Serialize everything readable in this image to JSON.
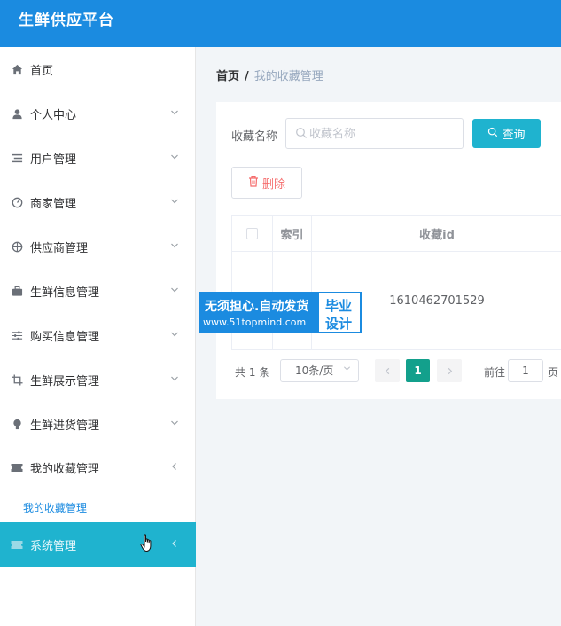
{
  "app": {
    "title": "生鲜供应平台"
  },
  "sidebar": {
    "items": [
      {
        "label": "首页",
        "icon": "home-icon"
      },
      {
        "label": "个人中心",
        "icon": "user-icon"
      },
      {
        "label": "用户管理",
        "icon": "list-icon"
      },
      {
        "label": "商家管理",
        "icon": "gauge-icon"
      },
      {
        "label": "供应商管理",
        "icon": "compass-icon"
      },
      {
        "label": "生鲜信息管理",
        "icon": "briefcase-icon"
      },
      {
        "label": "购买信息管理",
        "icon": "sliders-icon"
      },
      {
        "label": "生鲜展示管理",
        "icon": "crop-icon"
      },
      {
        "label": "生鲜进货管理",
        "icon": "bulb-icon"
      },
      {
        "label": "我的收藏管理",
        "icon": "ticket-icon"
      }
    ],
    "submenu": {
      "label": "我的收藏管理"
    },
    "active_item": {
      "label": "系统管理",
      "icon": "ticket-icon"
    }
  },
  "breadcrumb": {
    "home": "首页",
    "separator": "/",
    "current": "我的收藏管理"
  },
  "search": {
    "label": "收藏名称",
    "placeholder": "收藏名称",
    "value": "",
    "query_button": "查询"
  },
  "actions": {
    "delete_button": "删除"
  },
  "table": {
    "headers": {
      "index": "索引",
      "collect_id": "收藏id"
    },
    "rows": [
      {
        "collect_id": "1610462701529"
      }
    ]
  },
  "pagination": {
    "total": "共 1 条",
    "page_size": "10条/页",
    "current_page": "1",
    "goto_label": "前往",
    "goto_value": "1",
    "page_suffix": "页"
  },
  "watermark": {
    "line1": "无须担心.自动发货",
    "line2": "www.51topmind.com",
    "right1": "毕业",
    "right2": "设计"
  },
  "colors": {
    "primary": "#1b8be0",
    "accent": "#1fb3cf",
    "pager_active": "#13a08c",
    "danger": "#f56c6c"
  }
}
